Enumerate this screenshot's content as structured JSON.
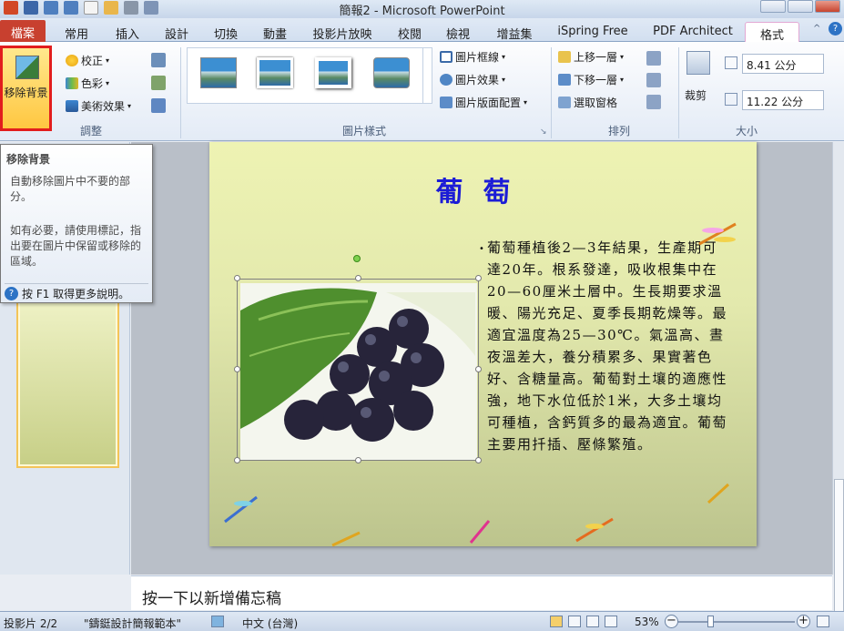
{
  "window": {
    "title": "簡報2 - Microsoft PowerPoint"
  },
  "tabs": [
    {
      "label": "檔案"
    },
    {
      "label": "常用"
    },
    {
      "label": "插入"
    },
    {
      "label": "設計"
    },
    {
      "label": "切換"
    },
    {
      "label": "動畫"
    },
    {
      "label": "投影片放映"
    },
    {
      "label": "校閱"
    },
    {
      "label": "檢視"
    },
    {
      "label": "增益集"
    },
    {
      "label": "iSpring Free"
    },
    {
      "label": "PDF Architect"
    },
    {
      "label": "格式"
    }
  ],
  "ribbon": {
    "remove_bg_label": "移除背景",
    "corrections_label": "校正",
    "color_label": "色彩",
    "artistic_label": "美術效果",
    "adjust_group": "調整",
    "picture_styles_group": "圖片樣式",
    "border_label": "圖片框線",
    "effects_label": "圖片效果",
    "layout_label": "圖片版面配置",
    "bring_forward_label": "上移一層",
    "send_backward_label": "下移一層",
    "selection_pane_label": "選取窗格",
    "arrange_group": "排列",
    "crop_label": "裁剪",
    "height_value": "8.41 公分",
    "width_value": "11.22 公分",
    "size_group": "大小"
  },
  "tooltip": {
    "title": "移除背景",
    "desc1": "自動移除圖片中不要的部分。",
    "desc2": "如有必要，請使用標記，指出要在圖片中保留或移除的區域。",
    "help": "按 F1 取得更多說明。"
  },
  "slide": {
    "title": "葡萄",
    "body": "葡萄種植後2—3年結果，生產期可達20年。根系發達，吸收根集中在20—60厘米土層中。生長期要求溫暖、陽光充足、夏季長期乾燥等。最適宜溫度為25—30℃。氣溫高、晝夜溫差大，養分積累多、果實著色好、含糖量高。葡萄對土壤的適應性強，地下水位低於1米，大多土壤均可種植，含鈣質多的最為適宜。葡萄主要用扦插、壓條繁殖。"
  },
  "notes": {
    "placeholder": "按一下以新增備忘稿"
  },
  "status": {
    "slide_info": "投影片 2/2",
    "theme": "\"鑄鋌設計簡報範本\"",
    "language": "中文 (台灣)",
    "zoom": "53%"
  },
  "colors": {
    "file_tab": "#c8402f",
    "highlight": "#e21d1d",
    "slide_title": "#1c1cd6"
  }
}
